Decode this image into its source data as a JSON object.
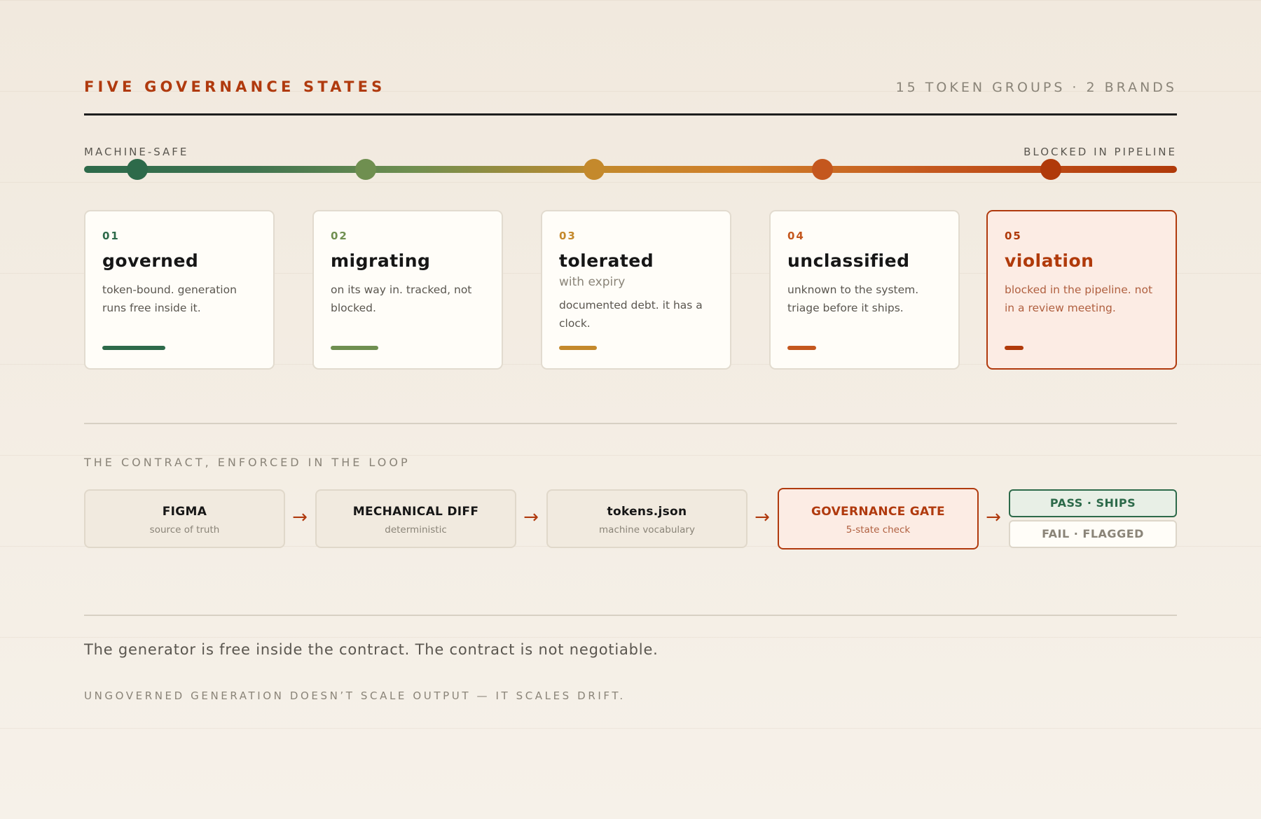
{
  "header": {
    "title": "FIVE GOVERNANCE STATES",
    "meta": "15 TOKEN GROUPS · 2 BRANDS"
  },
  "spectrum": {
    "left_label": "MACHINE-SAFE",
    "right_label": "BLOCKED IN PIPELINE"
  },
  "states": [
    {
      "num": "01",
      "title": "governed",
      "subtitle": "",
      "desc": "token-bound. generation runs free inside it.",
      "color": "#2d6a4a",
      "bar_fraction": 0.33
    },
    {
      "num": "02",
      "title": "migrating",
      "subtitle": "",
      "desc": "on its way in. tracked, not blocked.",
      "color": "#6f8f50",
      "bar_fraction": 0.25
    },
    {
      "num": "03",
      "title": "tolerated",
      "subtitle": "with expiry",
      "desc": "documented debt. it has a clock.",
      "color": "#c4892c",
      "bar_fraction": 0.2
    },
    {
      "num": "04",
      "title": "unclassified",
      "subtitle": "",
      "desc": "unknown to the system. triage before it ships.",
      "color": "#c4571e",
      "bar_fraction": 0.15
    },
    {
      "num": "05",
      "title": "violation",
      "subtitle": "",
      "desc": "blocked in the pipeline. not in a review meeting.",
      "color": "#b03a0a",
      "bar_fraction": 0.1
    }
  ],
  "pipeline": {
    "heading": "THE CONTRACT, ENFORCED IN THE LOOP",
    "steps": [
      {
        "label": "FIGMA",
        "sub": "source of truth"
      },
      {
        "label": "MECHANICAL DIFF",
        "sub": "deterministic"
      },
      {
        "label": "tokens.json",
        "sub": "machine vocabulary"
      },
      {
        "label": "GOVERNANCE GATE",
        "sub": "5-state check"
      }
    ],
    "arrow": "→",
    "pass": "PASS · SHIPS",
    "fail": "FAIL · FLAGGED"
  },
  "tagline": "The generator is free inside the contract. The contract is not negotiable.",
  "footnote": "UNGOVERNED GENERATION DOESN’T SCALE OUTPUT — IT SCALES DRIFT."
}
